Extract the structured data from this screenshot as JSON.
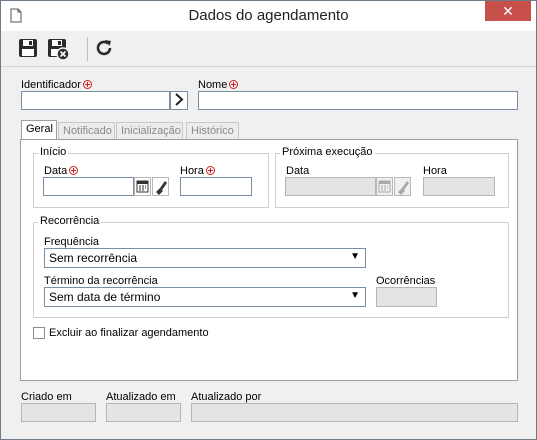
{
  "window": {
    "title": "Dados do agendamento"
  },
  "toolbar": {
    "buttons": [
      "save-icon",
      "save-and-close-icon",
      "refresh-icon"
    ]
  },
  "form": {
    "identifier_label": "Identificador",
    "identifier_value": "",
    "name_label": "Nome",
    "name_value": ""
  },
  "tabs": [
    {
      "label": "Geral",
      "active": true
    },
    {
      "label": "Notificado",
      "active": false
    },
    {
      "label": "Inicialização",
      "active": false
    },
    {
      "label": "Histórico",
      "active": false
    }
  ],
  "start": {
    "title": "Início",
    "date_label": "Data",
    "date_value": "",
    "time_label": "Hora",
    "time_value": ""
  },
  "next_run": {
    "title": "Próxima execução",
    "date_label": "Data",
    "date_value": "",
    "time_label": "Hora",
    "time_value": ""
  },
  "recurrence": {
    "title": "Recorrência",
    "frequency_label": "Frequência",
    "frequency_value": "Sem recorrência",
    "end_label": "Término da recorrência",
    "end_value": "Sem data de término",
    "occurrences_label": "Ocorrências",
    "occurrences_value": ""
  },
  "checkbox": {
    "label": "Excluir ao finalizar agendamento",
    "checked": false
  },
  "footer": {
    "created_label": "Criado em",
    "created_value": "",
    "updated_label": "Atualizado em",
    "updated_value": "",
    "updated_by_label": "Atualizado por",
    "updated_by_value": ""
  },
  "colors": {
    "required": "#d21f1f",
    "close": "#c7504b",
    "border": "#7a8da4"
  }
}
